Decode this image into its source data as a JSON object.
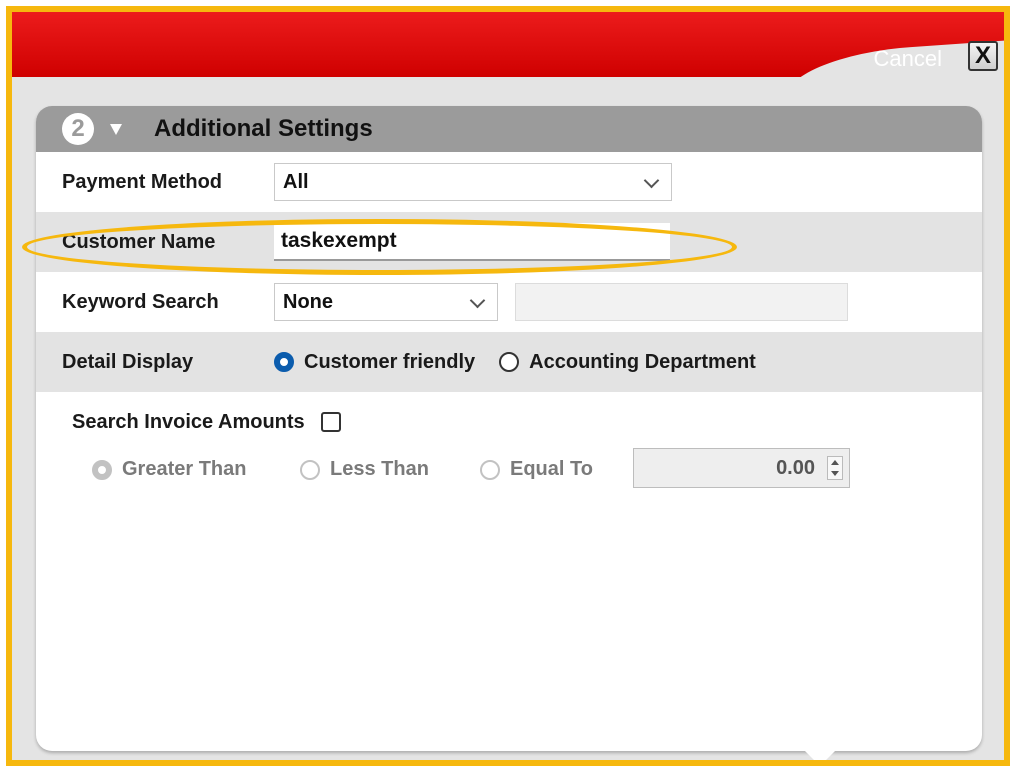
{
  "header": {
    "cancel_label": "Cancel",
    "close_glyph": "X"
  },
  "section": {
    "step_number": "2",
    "title": "Additional Settings"
  },
  "payment_method": {
    "label": "Payment Method",
    "value": "All"
  },
  "customer_name": {
    "label": "Customer Name",
    "value": "taskexempt"
  },
  "keyword_search": {
    "label": "Keyword Search",
    "value": "None",
    "text_value": ""
  },
  "detail_display": {
    "label": "Detail Display",
    "options": [
      "Customer friendly",
      "Accounting Department"
    ],
    "selected": "Customer friendly"
  },
  "invoice_search": {
    "label": "Search Invoice Amounts",
    "checked": false,
    "options": [
      "Greater Than",
      "Less Than",
      "Equal To"
    ],
    "selected": "Greater Than",
    "amount": "0.00"
  },
  "colors": {
    "header_red": "#d80000",
    "highlight": "#f6b80e",
    "radio_selected": "#0b5cad",
    "panel_header": "#9b9b9b"
  },
  "icons": [
    "close-icon",
    "collapse-triangle-icon",
    "chevron-down-icon",
    "spinner-icon"
  ]
}
